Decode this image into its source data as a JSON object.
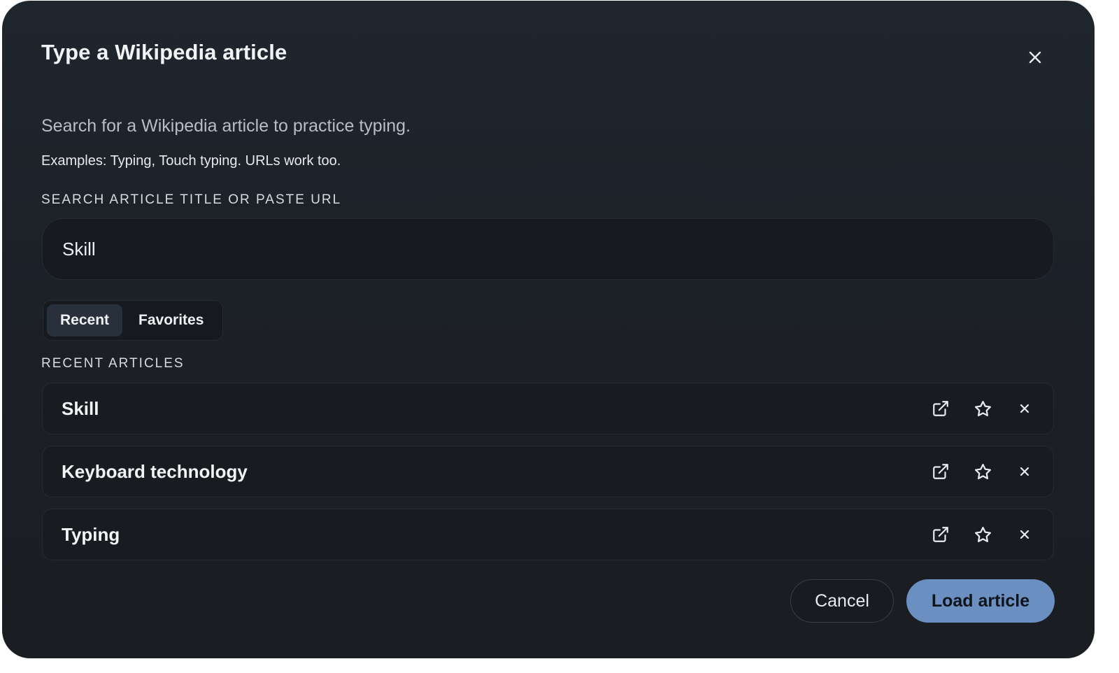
{
  "dialog": {
    "title": "Type a Wikipedia article",
    "subtitle": "Search for a Wikipedia article to practice typing.",
    "examples": "Examples: Typing, Touch typing. URLs work too.",
    "close_icon": "close-icon"
  },
  "search": {
    "label": "SEARCH ARTICLE TITLE OR PASTE URL",
    "value": "Skill"
  },
  "tabs": [
    {
      "label": "Recent",
      "active": true
    },
    {
      "label": "Favorites",
      "active": false
    }
  ],
  "recent": {
    "label": "RECENT ARTICLES",
    "items": [
      {
        "title": "Skill",
        "icons": [
          "external-link-icon",
          "star-icon",
          "close-icon"
        ]
      },
      {
        "title": "Keyboard technology",
        "icons": [
          "external-link-icon",
          "star-icon",
          "close-icon"
        ]
      },
      {
        "title": "Typing",
        "icons": [
          "external-link-icon",
          "star-icon",
          "close-icon"
        ]
      }
    ]
  },
  "footer": {
    "cancel_label": "Cancel",
    "load_label": "Load article"
  },
  "colors": {
    "background": "#1c2027",
    "accent": "#6b8fc0",
    "text": "#f1f3f5"
  }
}
